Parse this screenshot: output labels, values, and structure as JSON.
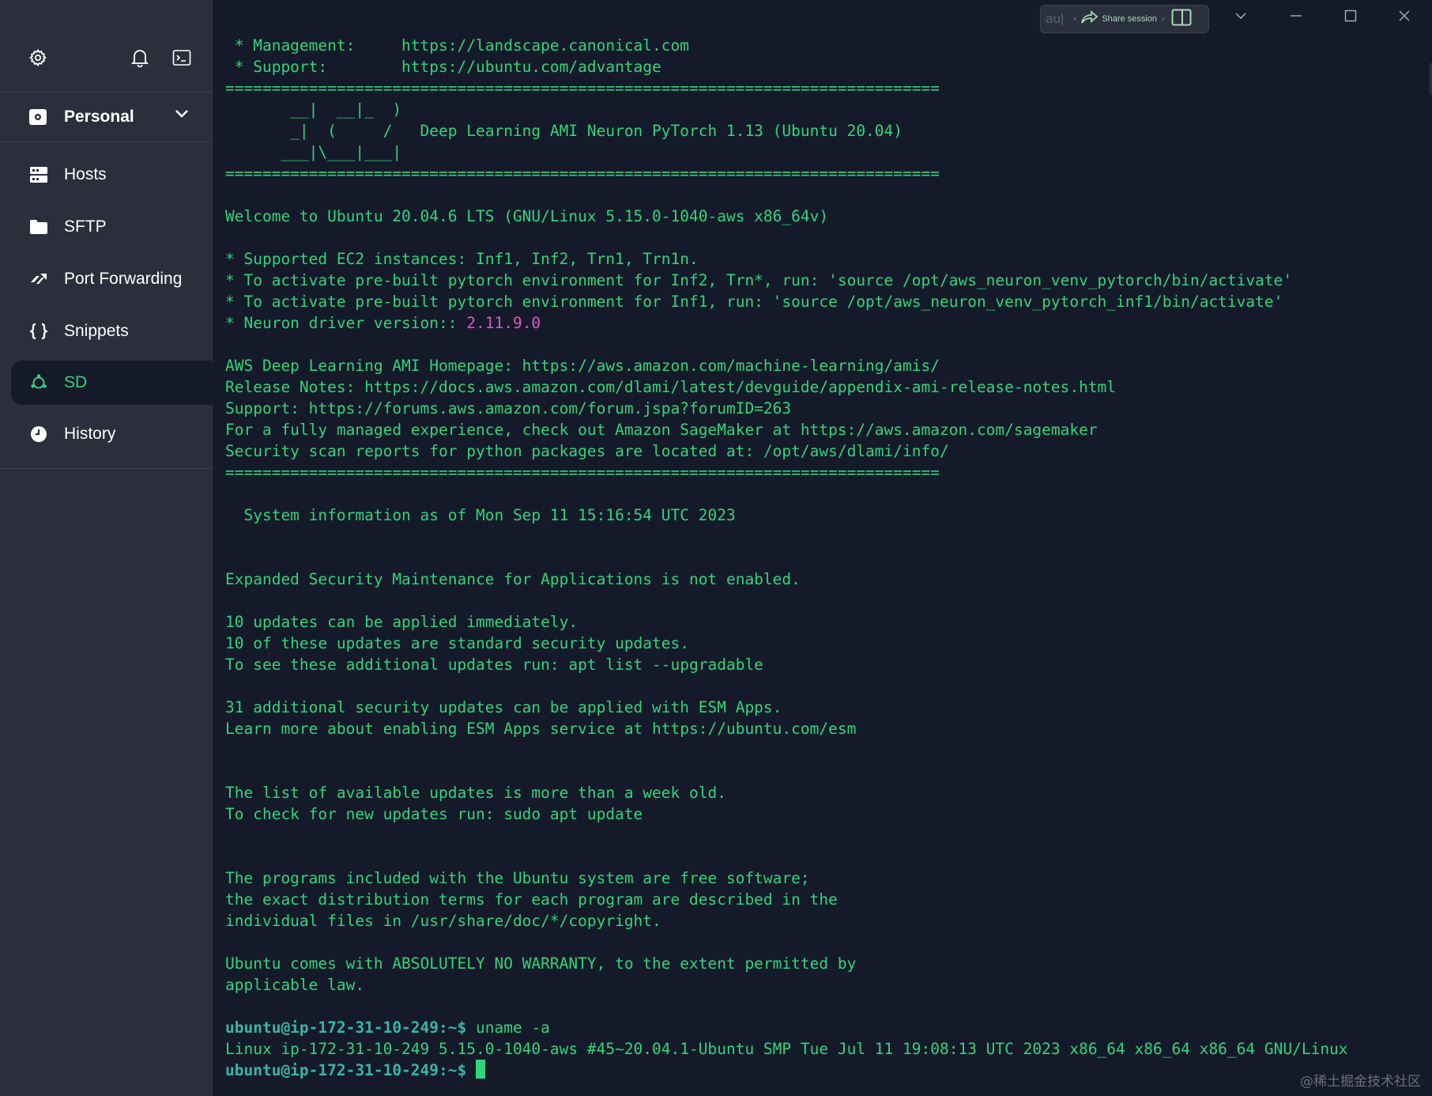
{
  "sidebar": {
    "vault": {
      "label": "Personal"
    },
    "items": [
      {
        "key": "hosts",
        "label": "Hosts"
      },
      {
        "key": "sftp",
        "label": "SFTP"
      },
      {
        "key": "port-forwarding",
        "label": "Port Forwarding"
      },
      {
        "key": "snippets",
        "label": "Snippets"
      },
      {
        "key": "sd",
        "label": "SD",
        "active": true
      },
      {
        "key": "history",
        "label": "History"
      }
    ]
  },
  "titlebar": {
    "pill_prefix": "au|",
    "share_label": "Share session"
  },
  "terminal": {
    "lines": [
      " * Management:     https://landscape.canonical.com",
      " * Support:        https://ubuntu.com/advantage",
      "=============================================================================",
      "       __|  __|_  )",
      "       _|  (     /   Deep Learning AMI Neuron PyTorch 1.13 (Ubuntu 20.04)",
      "      ___|\\___|___|",
      "=============================================================================",
      "",
      "Welcome to Ubuntu 20.04.6 LTS (GNU/Linux 5.15.0-1040-aws x86_64v)",
      "",
      "* Supported EC2 instances: Inf1, Inf2, Trn1, Trn1n.",
      "* To activate pre-built pytorch environment for Inf2, Trn*, run: 'source /opt/aws_neuron_venv_pytorch/bin/activate'",
      "* To activate pre-built pytorch environment for Inf1, run: 'source /opt/aws_neuron_venv_pytorch_inf1/bin/activate'",
      "* Neuron driver version:: ",
      "",
      "AWS Deep Learning AMI Homepage: https://aws.amazon.com/machine-learning/amis/",
      "Release Notes: https://docs.aws.amazon.com/dlami/latest/devguide/appendix-ami-release-notes.html",
      "Support: https://forums.aws.amazon.com/forum.jspa?forumID=263",
      "For a fully managed experience, check out Amazon SageMaker at https://aws.amazon.com/sagemaker",
      "Security scan reports for python packages are located at: /opt/aws/dlami/info/",
      "=============================================================================",
      "",
      "  System information as of Mon Sep 11 15:16:54 UTC 2023",
      "",
      "",
      "Expanded Security Maintenance for Applications is not enabled.",
      "",
      "10 updates can be applied immediately.",
      "10 of these updates are standard security updates.",
      "To see these additional updates run: apt list --upgradable",
      "",
      "31 additional security updates can be applied with ESM Apps.",
      "Learn more about enabling ESM Apps service at https://ubuntu.com/esm",
      "",
      "",
      "The list of available updates is more than a week old.",
      "To check for new updates run: sudo apt update",
      "",
      "",
      "The programs included with the Ubuntu system are free software;",
      "the exact distribution terms for each program are described in the",
      "individual files in /usr/share/doc/*/copyright.",
      "",
      "Ubuntu comes with ABSOLUTELY NO WARRANTY, to the extent permitted by",
      "applicable law.",
      ""
    ],
    "neuron_version": "2.11.9.0",
    "prompt_user_host": "ubuntu@ip-172-31-10-249",
    "prompt_suffix": ":~$ ",
    "command": "uname -a",
    "command_output": "Linux ip-172-31-10-249 5.15.0-1040-aws #45~20.04.1-Ubuntu SMP Tue Jul 11 19:08:13 UTC 2023 x86_64 x86_64 x86_64 GNU/Linux"
  },
  "watermark": "@稀土掘金技术社区",
  "colors": {
    "accent": "#2fd57a",
    "prompt": "#39b5a5",
    "highlight": "#e054c8",
    "sidebar_bg": "#2a2f3b",
    "terminal_bg": "#151a2a"
  }
}
